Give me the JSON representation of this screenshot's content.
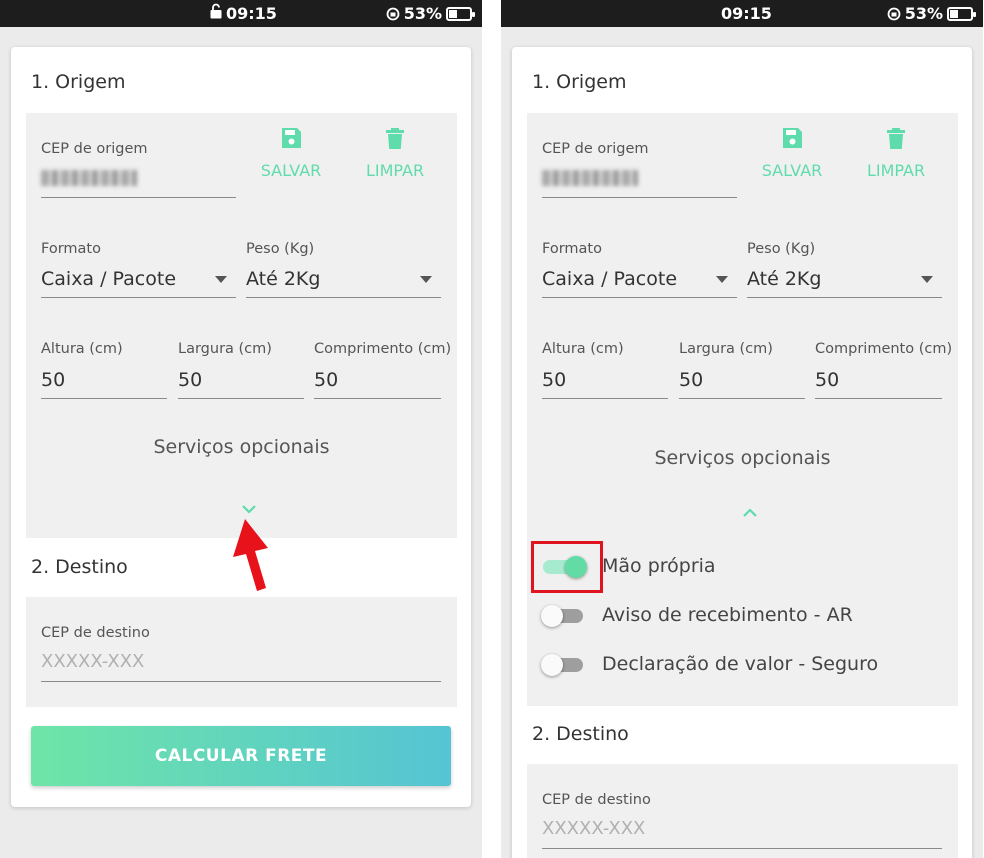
{
  "left": {
    "status": {
      "time": "09:15",
      "battery": "53%"
    },
    "origem": {
      "title": "1. Origem",
      "cep_label": "CEP de origem",
      "save_label": "SALVAR",
      "clear_label": "LIMPAR",
      "formato_label": "Formato",
      "formato_value": "Caixa / Pacote",
      "peso_label": "Peso (Kg)",
      "peso_value": "Até 2Kg",
      "altura_label": "Altura (cm)",
      "altura_value": "50",
      "largura_label": "Largura (cm)",
      "largura_value": "50",
      "comprimento_label": "Comprimento (cm)",
      "comprimento_value": "50",
      "opcionais_label": "Serviços opcionais"
    },
    "destino": {
      "title": "2. Destino",
      "cep_label": "CEP de destino",
      "cep_placeholder": "XXXXX-XXX"
    },
    "calc_button": "CALCULAR FRETE"
  },
  "right": {
    "status": {
      "time": "09:15",
      "battery": "53%"
    },
    "origem": {
      "title": "1. Origem",
      "cep_label": "CEP de origem",
      "save_label": "SALVAR",
      "clear_label": "LIMPAR",
      "formato_label": "Formato",
      "formato_value": "Caixa / Pacote",
      "peso_label": "Peso (Kg)",
      "peso_value": "Até 2Kg",
      "altura_label": "Altura (cm)",
      "altura_value": "50",
      "largura_label": "Largura (cm)",
      "largura_value": "50",
      "comprimento_label": "Comprimento (cm)",
      "comprimento_value": "50",
      "opcionais_label": "Serviços opcionais"
    },
    "opcionais": [
      {
        "label": "Mão própria",
        "on": true
      },
      {
        "label": "Aviso de recebimento - AR",
        "on": false
      },
      {
        "label": "Declaração de valor - Seguro",
        "on": false
      }
    ],
    "destino": {
      "title": "2. Destino",
      "cep_label": "CEP de destino",
      "cep_placeholder": "XXXXX-XXX"
    }
  },
  "colors": {
    "accent": "#5fdcab",
    "highlight": "#e0141e",
    "arrow": "#e8121b"
  }
}
